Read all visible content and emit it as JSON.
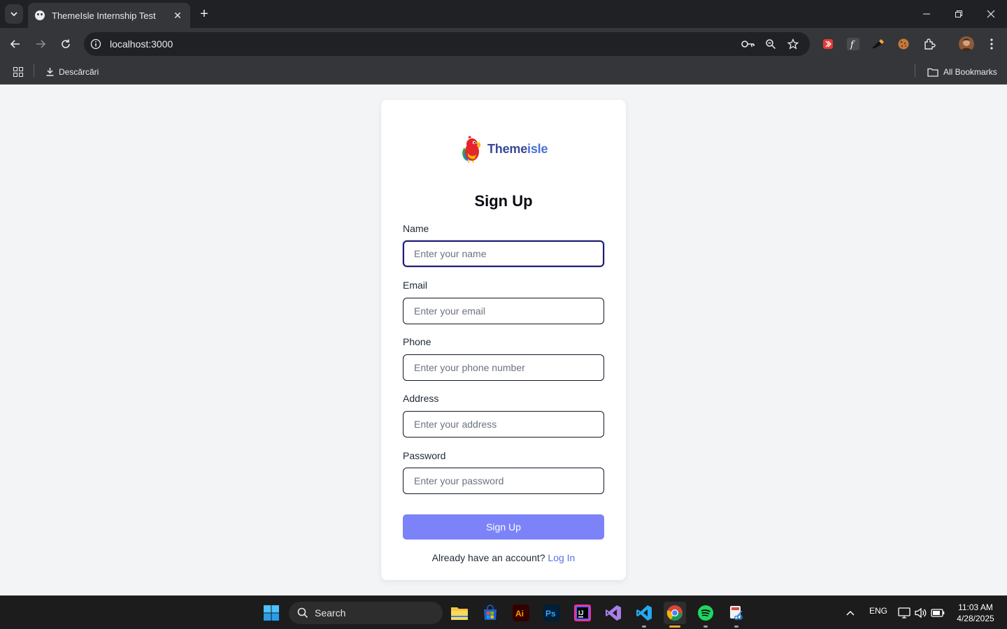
{
  "browser": {
    "tab_title": "ThemeIsle Internship Test",
    "url": "localhost:3000",
    "bookmarks": {
      "downloads_label": "Descărcări",
      "all_bookmarks_label": "All Bookmarks"
    }
  },
  "logo": {
    "text_main": "Theme",
    "text_accent": "isle",
    "icon": "parrot-logo-icon"
  },
  "form": {
    "title": "Sign Up",
    "fields": [
      {
        "label": "Name",
        "placeholder": "Enter your name",
        "value": ""
      },
      {
        "label": "Email",
        "placeholder": "Enter your email",
        "value": ""
      },
      {
        "label": "Phone",
        "placeholder": "Enter your phone number",
        "value": ""
      },
      {
        "label": "Address",
        "placeholder": "Enter your address",
        "value": ""
      },
      {
        "label": "Password",
        "placeholder": "Enter your password",
        "value": ""
      }
    ],
    "submit_label": "Sign Up",
    "footer_text": "Already have an account?",
    "footer_link": "Log In"
  },
  "taskbar": {
    "search_label": "Search",
    "language": "ENG",
    "time": "11:03 AM",
    "date": "4/28/2025",
    "apps": [
      "file-explorer-icon",
      "microsoft-store-icon",
      "illustrator-icon",
      "photoshop-icon",
      "intellij-icon",
      "visual-studio-icon",
      "vscode-icon",
      "chrome-icon",
      "spotify-icon",
      "snipping-tool-icon"
    ]
  },
  "colors": {
    "accent_button": "#7c83f9",
    "link": "#5b6ee8",
    "logo_text": "#36499b",
    "page_background": "#f3f4f6"
  }
}
